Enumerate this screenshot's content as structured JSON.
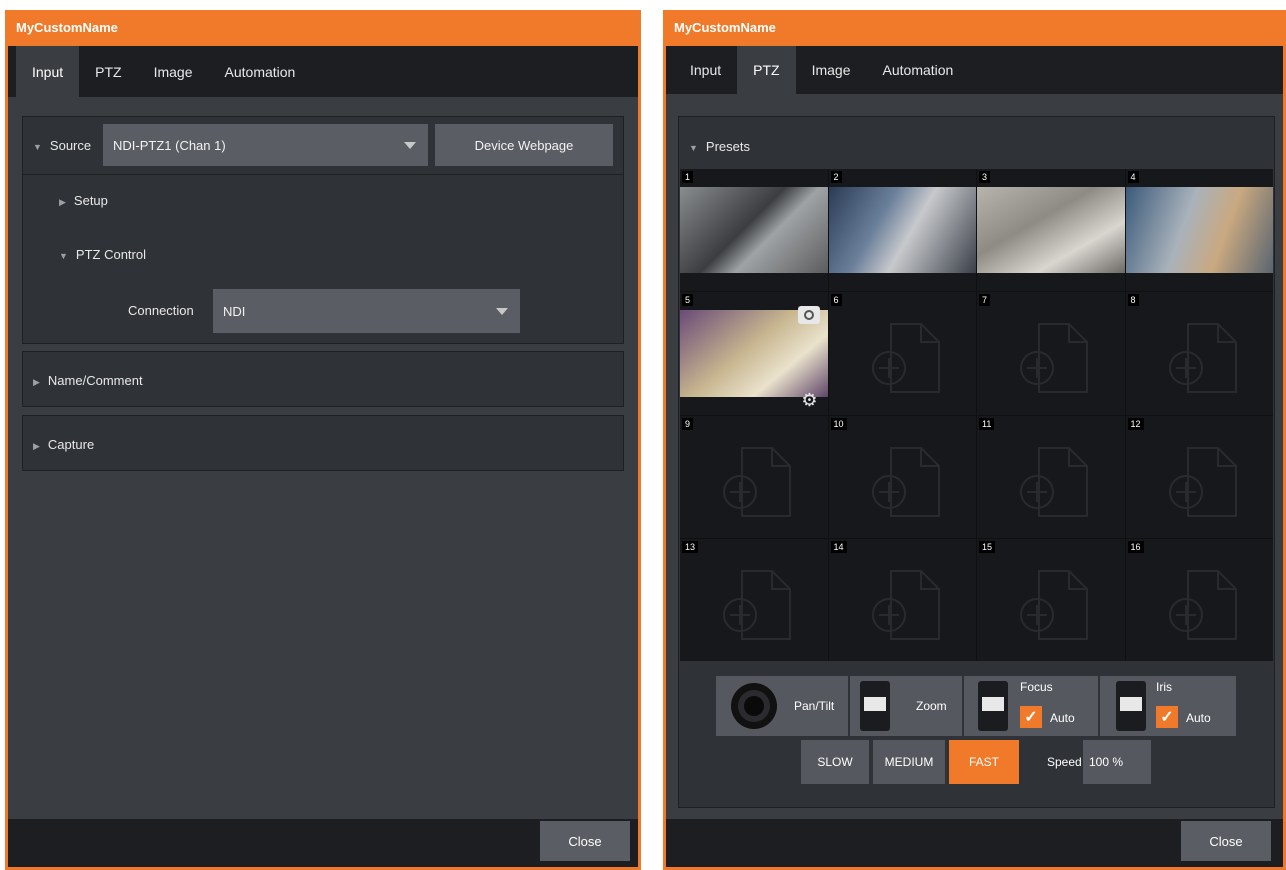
{
  "left_window": {
    "title": "MyCustomName",
    "tabs": [
      "Input",
      "PTZ",
      "Image",
      "Automation"
    ],
    "active_tab": "Input",
    "source_label": "Source",
    "source_value": "NDI-PTZ1 (Chan 1)",
    "device_webpage_button": "Device Webpage",
    "setup_label": "Setup",
    "ptz_control_label": "PTZ Control",
    "connection_label": "Connection",
    "connection_value": "NDI",
    "name_comment_label": "Name/Comment",
    "capture_label": "Capture",
    "close_button": "Close"
  },
  "right_window": {
    "title": "MyCustomName",
    "tabs": [
      "Input",
      "PTZ",
      "Image",
      "Automation"
    ],
    "active_tab": "PTZ",
    "presets_label": "Presets",
    "presets": [
      {
        "num": "1",
        "filled": true
      },
      {
        "num": "2",
        "filled": true
      },
      {
        "num": "3",
        "filled": true
      },
      {
        "num": "4",
        "filled": true
      },
      {
        "num": "5",
        "filled": true
      },
      {
        "num": "6",
        "filled": false
      },
      {
        "num": "7",
        "filled": false
      },
      {
        "num": "8",
        "filled": false
      },
      {
        "num": "9",
        "filled": false
      },
      {
        "num": "10",
        "filled": false
      },
      {
        "num": "11",
        "filled": false
      },
      {
        "num": "12",
        "filled": false
      },
      {
        "num": "13",
        "filled": false
      },
      {
        "num": "14",
        "filled": false
      },
      {
        "num": "15",
        "filled": false
      },
      {
        "num": "16",
        "filled": false
      }
    ],
    "pan_tilt_label": "Pan/Tilt",
    "zoom_label": "Zoom",
    "focus_label": "Focus",
    "iris_label": "Iris",
    "auto_label": "Auto",
    "focus_auto_checked": true,
    "iris_auto_checked": true,
    "speed_buttons": [
      "SLOW",
      "MEDIUM",
      "FAST"
    ],
    "active_speed": "FAST",
    "speed_label": "Speed",
    "speed_value": "100 %",
    "close_button": "Close"
  },
  "colors": {
    "accent": "#f07a2a",
    "panel": "#2f3237",
    "window_bg": "#3a3d42",
    "tabbar": "#1c1e22"
  }
}
